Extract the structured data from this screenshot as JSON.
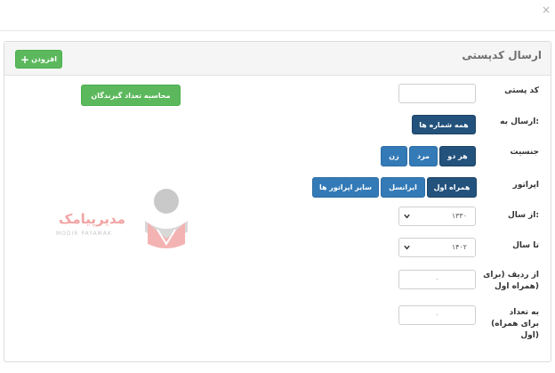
{
  "modal": {
    "close_glyph": "×"
  },
  "panel": {
    "title": "ارسال کدپستی",
    "add_button": "افزودن"
  },
  "form": {
    "postal_code": {
      "label": "کد پستی",
      "value": ""
    },
    "send_to": {
      "label": "ارسال به:",
      "button": "همه شماره ها"
    },
    "gender": {
      "label": "جنسیت",
      "options": [
        "هر دو",
        "مرد",
        "زن"
      ],
      "selected": "هر دو"
    },
    "operator": {
      "label": "اپراتور",
      "options": [
        "همراه اول",
        "ایرانسل",
        "سایر اپراتور ها"
      ],
      "selected": "همراه اول"
    },
    "from_year": {
      "label": "از سال:",
      "value": "۱۳۳۰"
    },
    "to_year": {
      "label": "تا سال",
      "value": "۱۴۰۲"
    },
    "from_row": {
      "label_line1": "از ردیف (برای",
      "label_line2": "همراه اول)",
      "value": "۰"
    },
    "count": {
      "label_line1": "به تعداد",
      "label_line2": "(برای همراه",
      "label_line3": "اول)",
      "value": "۰"
    },
    "count_button": "محاسبه تعداد گیرندگان"
  },
  "watermark": {
    "brand_fa": "مدیرپیامک",
    "brand_en": "MODIR PAYAMAK"
  },
  "colors": {
    "green": "#5cb85c",
    "blue": "#337ab7",
    "blue_active": "#23527c",
    "watermark_red": "#f2a3a3"
  }
}
